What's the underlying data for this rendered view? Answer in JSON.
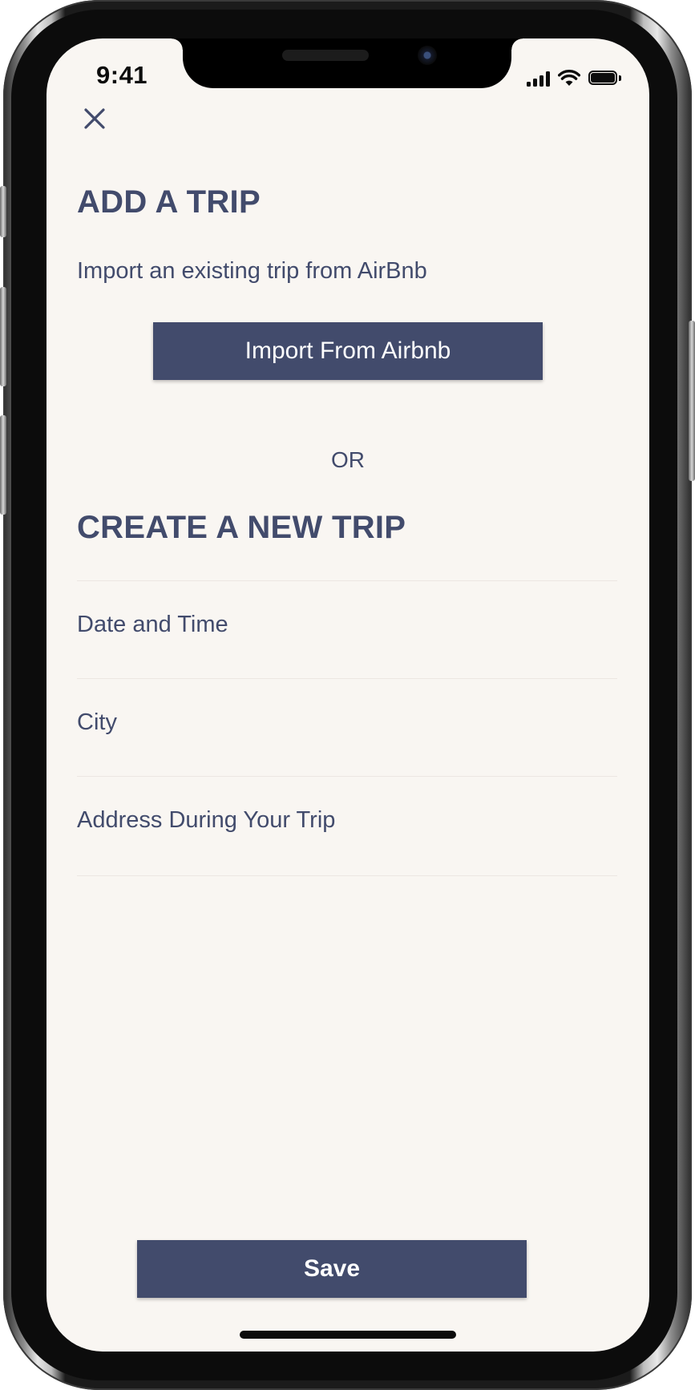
{
  "status_bar": {
    "time": "9:41"
  },
  "header": {
    "close_icon": "close-icon"
  },
  "import_section": {
    "title": "ADD A TRIP",
    "subtitle": "Import an existing trip from AirBnb",
    "button_label": "Import From Airbnb"
  },
  "divider_label": "OR",
  "create_section": {
    "title": "CREATE A NEW TRIP",
    "fields": [
      {
        "label": "Date and Time"
      },
      {
        "label": "City"
      },
      {
        "label": "Address During Your Trip"
      }
    ]
  },
  "footer": {
    "save_label": "Save"
  },
  "colors": {
    "primary": "#424b6c",
    "background": "#f9f6f2"
  }
}
